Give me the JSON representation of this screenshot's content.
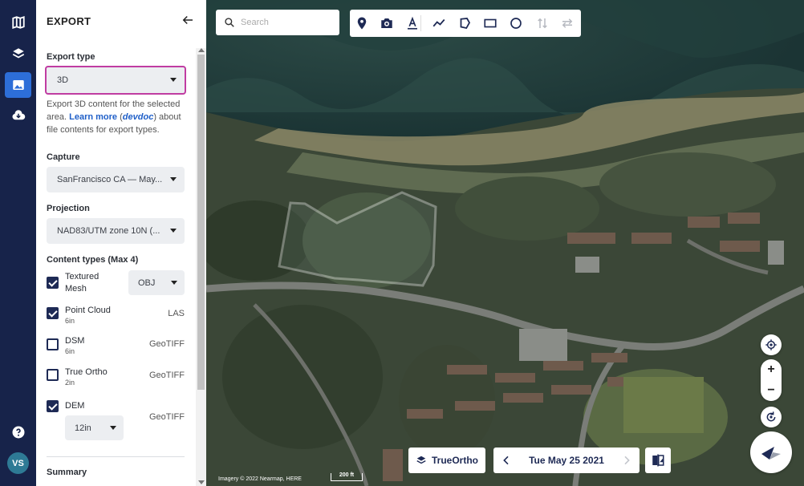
{
  "panel": {
    "title": "EXPORT",
    "export_type": {
      "label": "Export type",
      "value": "3D"
    },
    "help": {
      "prefix": "Export 3D content for the selected area. ",
      "learn_more": "Learn more",
      "open": " (",
      "devdoc": "devdoc",
      "suffix": ") about file contents for export types."
    },
    "capture": {
      "label": "Capture",
      "value": "SanFrancisco CA — May..."
    },
    "projection": {
      "label": "Projection",
      "value": "NAD83/UTM zone 10N (..."
    },
    "content_types": {
      "label": "Content types (Max 4)",
      "items": [
        {
          "name_line1": "Textured",
          "name_line2": "Mesh",
          "sub": "",
          "format": "OBJ",
          "checked": true
        },
        {
          "name_line1": "Point Cloud",
          "sub": "6in",
          "format": "LAS",
          "checked": true
        },
        {
          "name_line1": "DSM",
          "sub": "6in",
          "format": "GeoTIFF",
          "checked": false
        },
        {
          "name_line1": "True Ortho",
          "sub": "2in",
          "format": "GeoTIFF",
          "checked": false
        },
        {
          "name_line1": "DEM",
          "sub": "",
          "format": "GeoTIFF",
          "resolution": "12in",
          "checked": true
        }
      ]
    },
    "summary": "Summary"
  },
  "user": {
    "initials": "VS"
  },
  "map": {
    "search_placeholder": "Search",
    "layer_button": "TrueOrtho",
    "date": "Tue May 25 2021",
    "attribution": "Imagery © 2022 Nearmap, HERE",
    "scale": "200 ft"
  },
  "colors": {
    "rail": "#17234a",
    "accent": "#2d6ed8",
    "focus_outline": "#c03ca2",
    "link": "#1f5fc8"
  }
}
